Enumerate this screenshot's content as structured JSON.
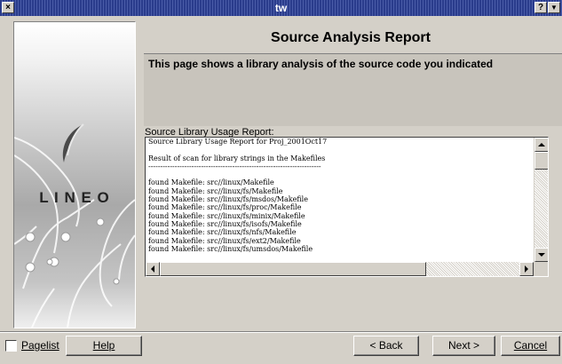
{
  "window": {
    "title": "tw",
    "close_glyph": "×",
    "help_glyph": "?",
    "menu_glyph": "▼"
  },
  "logo": {
    "wordmark": "L I N E O"
  },
  "page": {
    "heading": "Source Analysis Report",
    "subtitle": "This page shows a library analysis of the source code you indicated"
  },
  "report": {
    "label": "Source Library Usage Report:",
    "lines": [
      "Source Library Usage Report for Proj_2001Oct17",
      "",
      "Result of scan for library strings in the Makefiles",
      "------------------------------------------------------------------------",
      "",
      "found Makefile: src//linux/Makefile",
      "found Makefile: src//linux/fs/Makefile",
      "found Makefile: src//linux/fs/msdos/Makefile",
      "found Makefile: src//linux/fs/proc/Makefile",
      "found Makefile: src//linux/fs/minix/Makefile",
      "found Makefile: src//linux/fs/isofs/Makefile",
      "found Makefile: src//linux/fs/nfs/Makefile",
      "found Makefile: src//linux/fs/ext2/Makefile",
      "found Makefile: src//linux/fs/umsdos/Makefile"
    ],
    "scroll_up_icon": "up-arrow",
    "scroll_down_icon": "down-arrow",
    "scroll_left_icon": "left-arrow",
    "scroll_right_icon": "right-arrow"
  },
  "footer": {
    "pagelist_label": "Pagelist",
    "pagelist_checked": false,
    "help_label": "Help",
    "back_label": "< Back",
    "next_label": "Next >",
    "cancel_label": "Cancel"
  }
}
